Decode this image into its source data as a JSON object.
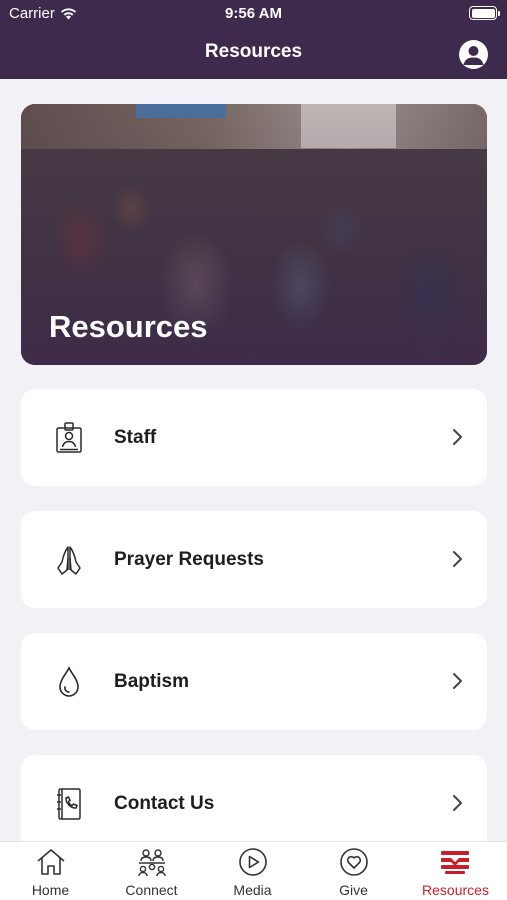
{
  "status_bar": {
    "carrier": "Carrier",
    "time": "9:56 AM"
  },
  "nav": {
    "title": "Resources",
    "profile_icon": "person-circle-icon"
  },
  "hero": {
    "title": "Resources"
  },
  "menu": [
    {
      "label": "Staff",
      "icon": "id-badge-icon"
    },
    {
      "label": "Prayer Requests",
      "icon": "praying-hands-icon"
    },
    {
      "label": "Baptism",
      "icon": "water-drop-icon"
    },
    {
      "label": "Contact Us",
      "icon": "phone-book-icon"
    }
  ],
  "tabs": [
    {
      "label": "Home",
      "icon": "home-icon"
    },
    {
      "label": "Connect",
      "icon": "people-group-icon"
    },
    {
      "label": "Media",
      "icon": "play-circle-icon"
    },
    {
      "label": "Give",
      "icon": "heart-circle-icon"
    },
    {
      "label": "Resources",
      "icon": "resources-icon",
      "active": true
    }
  ],
  "colors": {
    "primary": "#3e2a4d",
    "active_tab": "#c8202a",
    "background": "#f2f2f6"
  }
}
